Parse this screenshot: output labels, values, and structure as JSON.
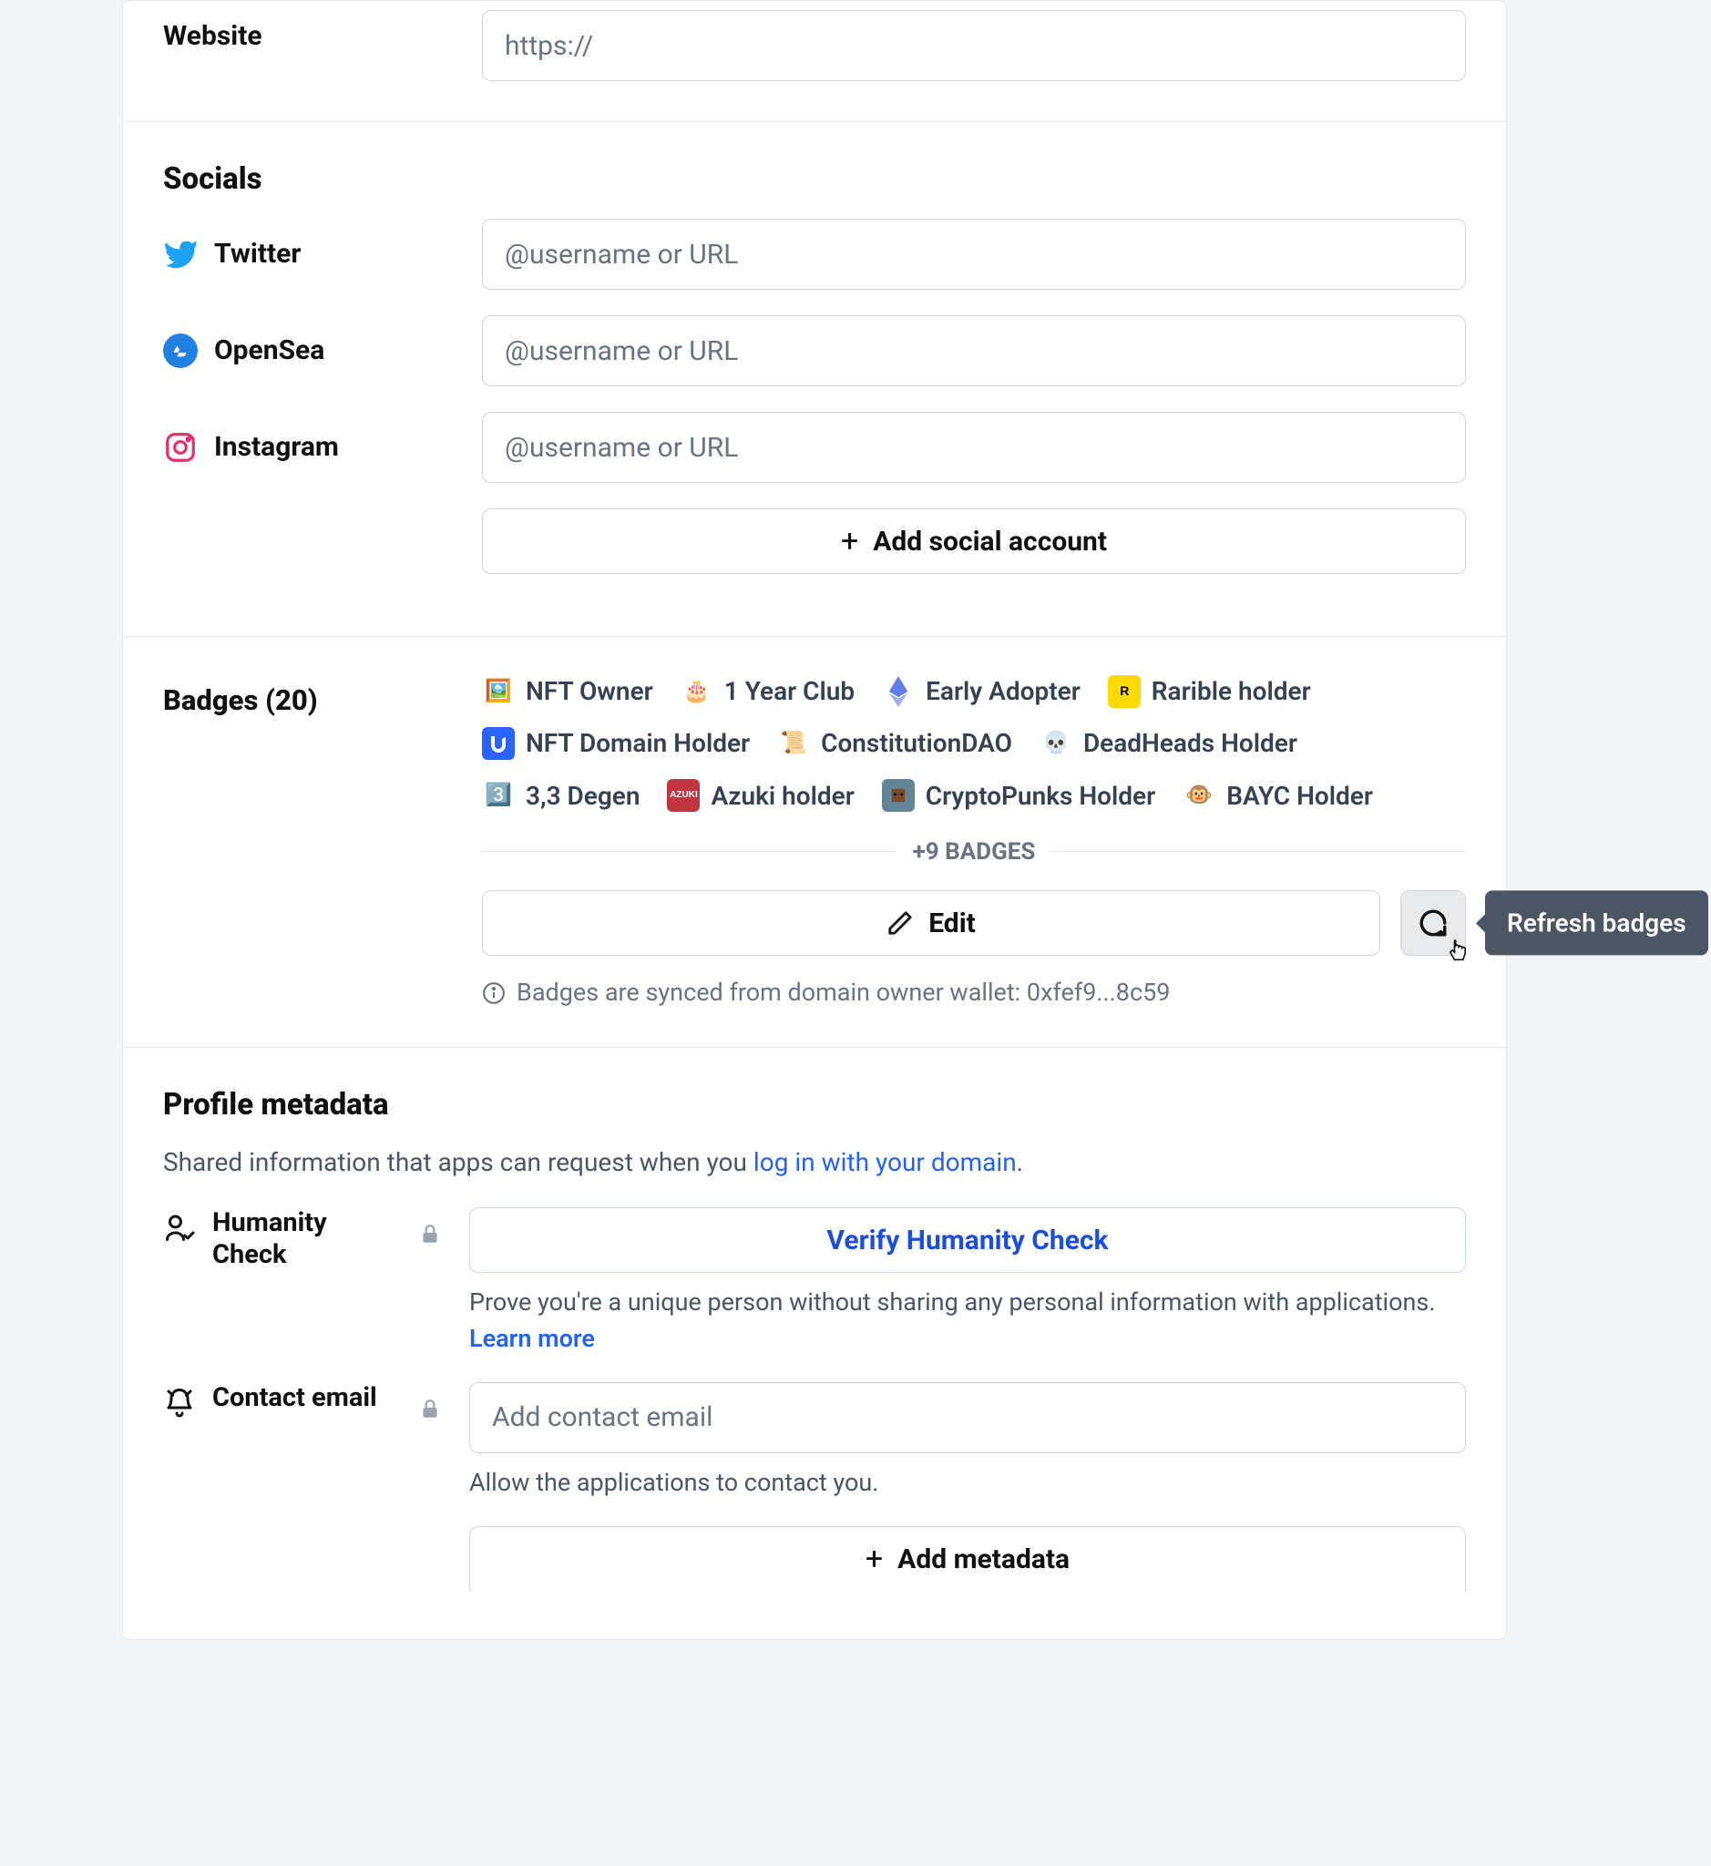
{
  "website": {
    "label": "Website",
    "placeholder": "https://"
  },
  "socials": {
    "title": "Socials",
    "items": [
      {
        "key": "twitter",
        "label": "Twitter",
        "placeholder": "@username or URL"
      },
      {
        "key": "opensea",
        "label": "OpenSea",
        "placeholder": "@username or URL"
      },
      {
        "key": "instagram",
        "label": "Instagram",
        "placeholder": "@username or URL"
      }
    ],
    "add_label": "Add social account"
  },
  "badges": {
    "title": "Badges (20)",
    "items": [
      {
        "label": "NFT Owner",
        "emoji": "🖼️",
        "bg": ""
      },
      {
        "label": "1 Year Club",
        "emoji": "🎂",
        "bg": ""
      },
      {
        "label": "Early Adopter",
        "emoji": "",
        "bg": "",
        "svg": "eth"
      },
      {
        "label": "Rarible holder",
        "emoji": "",
        "bg": "#FEDA03",
        "svg": "rarible"
      },
      {
        "label": "NFT Domain Holder",
        "emoji": "",
        "bg": "#2962FF",
        "svg": "ud"
      },
      {
        "label": "ConstitutionDAO",
        "emoji": "📜",
        "bg": ""
      },
      {
        "label": "DeadHeads Holder",
        "emoji": "💀",
        "bg": ""
      },
      {
        "label": "3,3 Degen",
        "emoji": "3️⃣",
        "bg": ""
      },
      {
        "label": "Azuki holder",
        "emoji": "",
        "bg": "#C03540",
        "svg": "azuki"
      },
      {
        "label": "CryptoPunks Holder",
        "emoji": "",
        "bg": "#638596",
        "svg": "punk"
      },
      {
        "label": "BAYC Holder",
        "emoji": "🐵",
        "bg": ""
      }
    ],
    "more": "+9 BADGES",
    "edit_label": "Edit",
    "refresh_tooltip": "Refresh badges",
    "info": "Badges are synced from domain owner wallet: 0xfef9...8c59"
  },
  "metadata": {
    "title": "Profile metadata",
    "desc_prefix": "Shared information that apps can request when you ",
    "desc_link": "log in with your domain",
    "desc_suffix": ".",
    "humanity": {
      "label": "Humanity Check",
      "button": "Verify Humanity Check",
      "helper": "Prove you're a unique person without sharing any personal information with applications.",
      "learn_more": "Learn more"
    },
    "contact": {
      "label": "Contact email",
      "placeholder": "Add contact email",
      "helper": "Allow the applications to contact you."
    },
    "add_label": "Add metadata"
  }
}
